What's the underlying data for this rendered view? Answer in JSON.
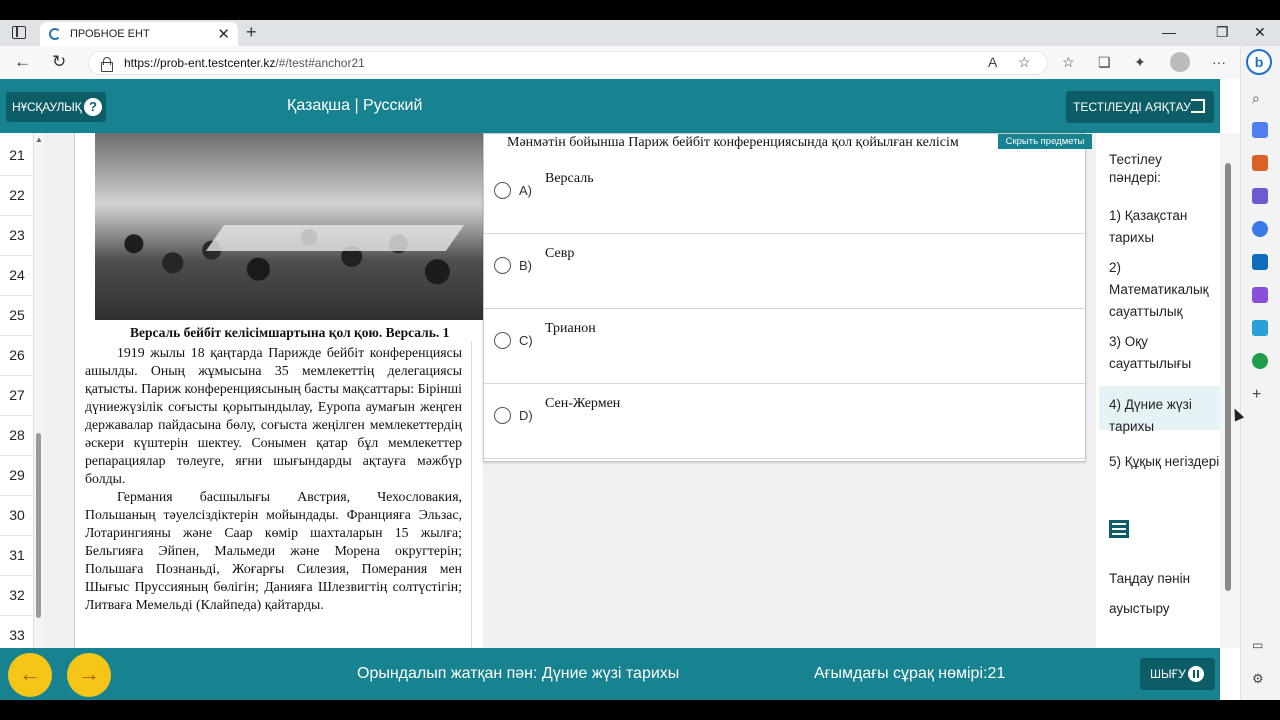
{
  "browser": {
    "tab_title": "ПРОБНОЕ ЕНТ",
    "url_domain": "https://prob-ent.testcenter.kz",
    "url_path": "/#/test#anchor21",
    "new_tab_symbol": "+",
    "close_symbol": "✕",
    "minimize_symbol": "—",
    "restore_symbol": "❐",
    "window_close_symbol": "✕"
  },
  "header": {
    "guide_label": "НҰСҚАУЛЫҚ",
    "guide_icon": "?",
    "languages": "Қазақша | Русский",
    "finish_label": "ТЕСТІЛЕУДІ АЯҚТАУ"
  },
  "question_numbers": [
    "21",
    "22",
    "23",
    "24",
    "25",
    "26",
    "27",
    "28",
    "29",
    "30",
    "31",
    "32",
    "33"
  ],
  "passage": {
    "caption": "Версаль бейбіт келісімшартына қол қою. Версаль. 1",
    "paragraph1": "1919 жылы 18 қаңтарда Парижде бейбіт конференциясы ашылды. Оның жұмысына 35 мемлекеттің делегациясы қатысты. Париж конференциясының басты мақсаттары: Бірінші дүниежүзілік соғысты қорытындылау, Еуропа аумағын жеңген державалар пайдасына бөлу, соғыста жеңілген мемлекеттердің әскери күштерін шектеу. Сонымен қатар бұл мемлекеттер репарациялар төлеуге, яғни шығындарды ақтауға мәжбүр болды.",
    "paragraph2": "Германия басшылығы Австрия, Чехословакия, Польшаның тәуелсіздіктерін мойындады. Францияға Эльзас, Лотарингияны және Саар көмір шахталарын 15 жылға; Бельгияға Эйпен, Мальмеди және Морена округтерін; Польшаға Познаньді, Жоғарғы Силезия, Померания мен Шығыс Пруссияның бөлігін; Данияға Шлезвигтің солтүстігін; Литваға Мемельді (Клайпеда) қайтарды."
  },
  "question": {
    "text": "Мәнмәтін бойынша Париж бейбіт конференциясында қол қойылған келісім",
    "hide_button": "Скрыть предметы",
    "options": [
      {
        "letter": "A)",
        "text": "Версаль"
      },
      {
        "letter": "B)",
        "text": "Севр"
      },
      {
        "letter": "C)",
        "text": "Трианон"
      },
      {
        "letter": "D)",
        "text": "Сен-Жермен"
      }
    ]
  },
  "subjects": {
    "title": "Тестілеу пәндері:",
    "items": [
      "1) Қазақстан тарихы",
      "2) Математикалық сауаттылық",
      "3) Оқу сауаттылығы",
      "4) Дүние жүзі тарихы",
      "5) Құқық негіздері"
    ],
    "active_index": 3,
    "switch_label": "Таңдау пәнін ауыстыру"
  },
  "footer": {
    "prev_symbol": "←",
    "next_symbol": "→",
    "current_subject": "Орындалып жатқан пән: Дүние жүзі тарихы",
    "current_question": "Ағымдағы сұрақ нөмірі:21",
    "exit_label": "ШЫҒУ"
  },
  "colors": {
    "header_teal": "#178390",
    "button_dark": "#0d5d66",
    "nav_yellow": "#f5c518"
  }
}
